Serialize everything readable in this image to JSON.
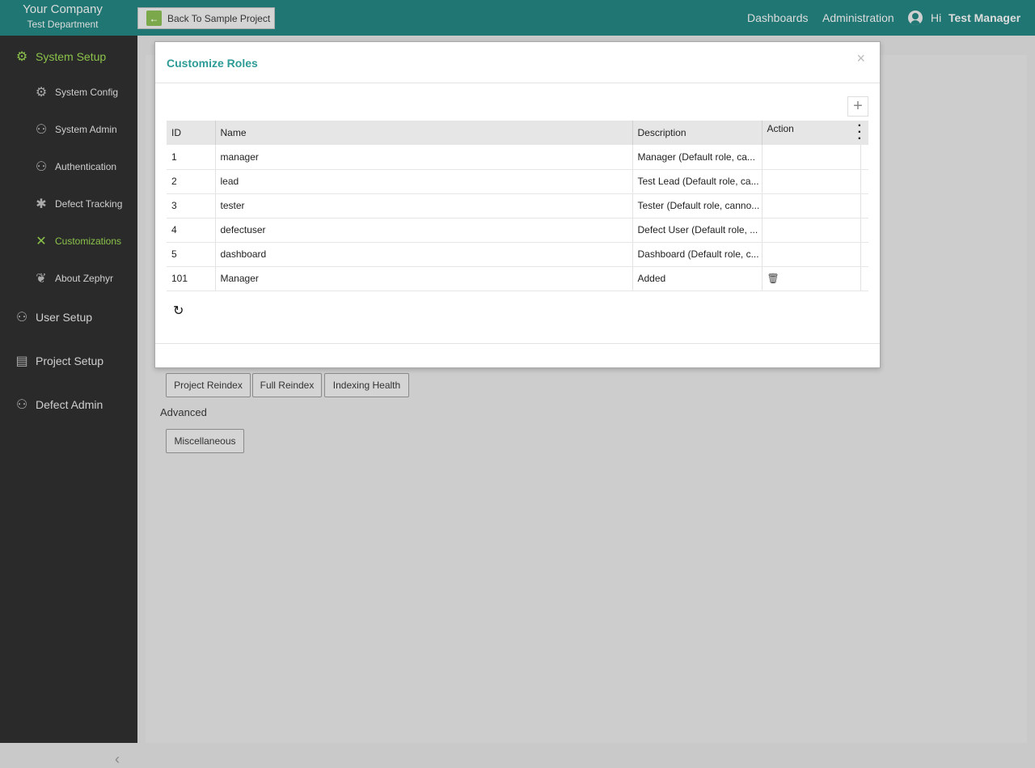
{
  "header": {
    "company": "Your Company",
    "department": "Test Department",
    "back_label": "Back To Sample Project",
    "nav": [
      "Dashboards",
      "Administration"
    ],
    "greeting": "Hi",
    "user": "Test Manager"
  },
  "sidebar": {
    "items": [
      {
        "label": "System Setup",
        "icon": "wrench-gear-icon",
        "level": "top",
        "active": true
      },
      {
        "label": "System Config",
        "icon": "gears-icon",
        "level": "sub"
      },
      {
        "label": "System Admin",
        "icon": "user-gear-icon",
        "level": "sub"
      },
      {
        "label": "Authentication",
        "icon": "user-check-icon",
        "level": "sub"
      },
      {
        "label": "Defect Tracking",
        "icon": "bug-icon",
        "level": "sub"
      },
      {
        "label": "Customizations",
        "icon": "pencil-ruler-icon",
        "level": "sub",
        "active": true
      },
      {
        "label": "About Zephyr",
        "icon": "wing-icon",
        "level": "sub"
      },
      {
        "label": "User Setup",
        "icon": "user-setup-icon",
        "level": "top"
      },
      {
        "label": "Project Setup",
        "icon": "project-icon",
        "level": "top"
      },
      {
        "label": "Defect Admin",
        "icon": "defect-admin-icon",
        "level": "top"
      }
    ]
  },
  "content": {
    "index_buttons": [
      "Project Reindex",
      "Full Reindex",
      "Indexing Health"
    ],
    "advanced_label": "Advanced",
    "misc_button": "Miscellaneous"
  },
  "modal": {
    "title": "Customize Roles",
    "columns": [
      "ID",
      "Name",
      "Description",
      "Action"
    ],
    "rows": [
      {
        "id": "1",
        "name": "manager",
        "description": "Manager (Default role, ca...",
        "deletable": false
      },
      {
        "id": "2",
        "name": "lead",
        "description": "Test Lead (Default role, ca...",
        "deletable": false
      },
      {
        "id": "3",
        "name": "tester",
        "description": "Tester (Default role, canno...",
        "deletable": false
      },
      {
        "id": "4",
        "name": "defectuser",
        "description": "Defect User (Default role, ...",
        "deletable": false
      },
      {
        "id": "5",
        "name": "dashboard",
        "description": "Dashboard (Default role, c...",
        "deletable": false
      },
      {
        "id": "101",
        "name": "Manager",
        "description": "Added",
        "deletable": true
      }
    ]
  },
  "colors": {
    "topbar": "#1f7673",
    "accent": "#8bc34a",
    "title": "#2d9b96"
  }
}
